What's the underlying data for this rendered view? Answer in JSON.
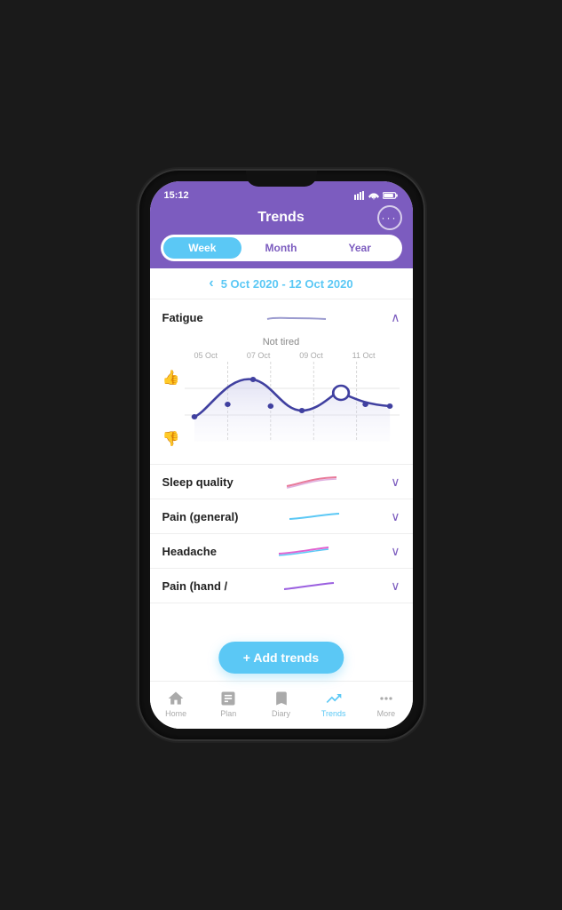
{
  "statusBar": {
    "time": "15:12"
  },
  "header": {
    "title": "Trends",
    "moreLabel": "···"
  },
  "tabs": [
    {
      "label": "Week",
      "active": true
    },
    {
      "label": "Month",
      "active": false
    },
    {
      "label": "Year",
      "active": false
    }
  ],
  "dateNav": {
    "prevArrow": "‹",
    "dateRange": "5 Oct 2020 - 12 Oct 2020"
  },
  "fatigue": {
    "title": "Fatigue",
    "expandedLabel": "Not tired",
    "xLabels": [
      "05 Oct",
      "07 Oct",
      "09 Oct",
      "11 Oct"
    ],
    "chevron": "∧"
  },
  "sleepQuality": {
    "title": "Sleep quality",
    "chevron": "∨"
  },
  "painGeneral": {
    "title": "Pain (general)",
    "chevron": "∨"
  },
  "headache": {
    "title": "Headache",
    "chevron": "∨"
  },
  "painHand": {
    "title": "Pain (hand /",
    "chevron": "∨"
  },
  "addTrendsBtn": "+ Add trends",
  "bottomNav": [
    {
      "label": "Home",
      "icon": "🏠",
      "active": false
    },
    {
      "label": "Plan",
      "icon": "📋",
      "active": false
    },
    {
      "label": "Diary",
      "icon": "📝",
      "active": false
    },
    {
      "label": "Trends",
      "icon": "📈",
      "active": true
    },
    {
      "label": "More",
      "icon": "💬",
      "active": false
    }
  ],
  "colors": {
    "purple": "#7c5cbf",
    "cyan": "#5bc8f5",
    "white": "#ffffff"
  }
}
